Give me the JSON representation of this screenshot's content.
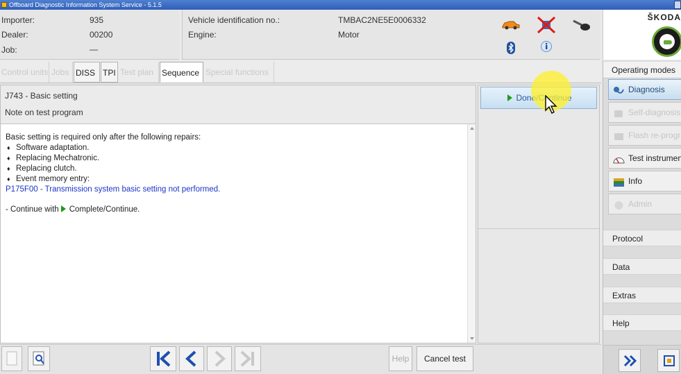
{
  "window": {
    "title": "Offboard Diagnostic Information System Service - 5.1.5"
  },
  "header": {
    "importer_label": "Importer:",
    "importer_value": "935",
    "dealer_label": "Dealer:",
    "dealer_value": "00200",
    "job_label": "Job:",
    "job_value": "—",
    "vin_label": "Vehicle identification no.:",
    "vin_value": "TMBAC2NE5E0006332",
    "engine_label": "Engine:",
    "engine_value": "Motor"
  },
  "brand": {
    "name": "ŠKODA"
  },
  "tabs": [
    {
      "label": "Control units",
      "state": "disabled"
    },
    {
      "label": "Jobs",
      "state": "disabled"
    },
    {
      "label": "DISS",
      "state": "enabled"
    },
    {
      "label": "TPI",
      "state": "enabled"
    },
    {
      "label": "Test plan",
      "state": "disabled"
    },
    {
      "label": "Sequence",
      "state": "active"
    },
    {
      "label": "Special functions",
      "state": "disabled"
    }
  ],
  "main": {
    "title": "J743 - Basic setting",
    "subtitle": "Note on test program",
    "intro": "Basic setting is required only after the following repairs:",
    "bullets": [
      "Software adaptation.",
      "Replacing Mechatronic.",
      "Replacing clutch.",
      "Event memory entry:"
    ],
    "fault_code": "P175F00 - Transmission system basic setting not performed.",
    "continue_prefix": "- Continue with",
    "continue_action": "Complete/Continue."
  },
  "action_panel": {
    "done_label": "Done/Continue"
  },
  "sidebar": {
    "title": "Operating modes",
    "modes": [
      {
        "label": "Diagnosis",
        "state": "selected"
      },
      {
        "label": "Self-diagnosis",
        "state": "disabled"
      },
      {
        "label": "Flash re-programming",
        "state": "disabled"
      },
      {
        "label": "Test instruments",
        "state": "enabled"
      },
      {
        "label": "Info",
        "state": "enabled"
      },
      {
        "label": "Admin",
        "state": "disabled"
      }
    ],
    "links": [
      "Protocol",
      "Data",
      "Extras",
      "Help"
    ]
  },
  "bottom": {
    "help_label": "Help",
    "cancel_label": "Cancel test"
  },
  "colors": {
    "accent_blue": "#2a5a9a",
    "fault_blue": "#1a35c8",
    "play_green": "#1f9a1f",
    "skoda_green": "#6aaa3a",
    "cursor_highlight": "#fff028"
  }
}
